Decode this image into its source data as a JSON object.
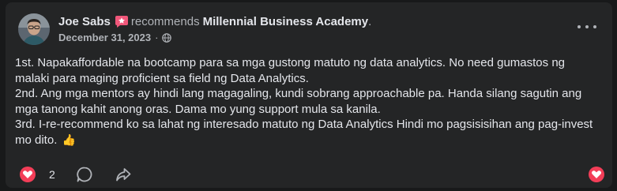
{
  "post": {
    "author": "Joe Sabs",
    "verb": "recommends",
    "page_name": "Millennial Business Academy",
    "period": ".",
    "date": "December 31, 2023",
    "separator": "·",
    "privacy_icon": "globe-icon",
    "paragraphs": [
      "1st. Napakaffordable na bootcamp para sa mga gustong matuto ng data analytics. No need gumastos ng malaki para maging proficient sa field ng Data Analytics.",
      "2nd. Ang mga mentors ay hindi lang magagaling, kundi sobrang approachable pa. Handa silang sagutin ang mga tanong kahit anong oras. Dama mo yung support mula sa kanila.",
      "3rd. I-re-recommend ko sa lahat ng interesado matuto ng Data Analytics Hindi mo pagsisisihan ang pag-invest mo dito."
    ],
    "emoji": "👍"
  },
  "reactions": {
    "count": "2"
  },
  "colors": {
    "background": "#18191a",
    "card": "#242526",
    "primary_text": "#e4e6eb",
    "secondary_text": "#b0b3b8",
    "heart_red": "#f33e58",
    "badge_pink": "#f0577a"
  },
  "icons": {
    "badge": "recommend-badge-icon",
    "more": "more-options-icon",
    "heart": "heart-icon",
    "comment": "comment-icon",
    "share": "share-icon"
  }
}
